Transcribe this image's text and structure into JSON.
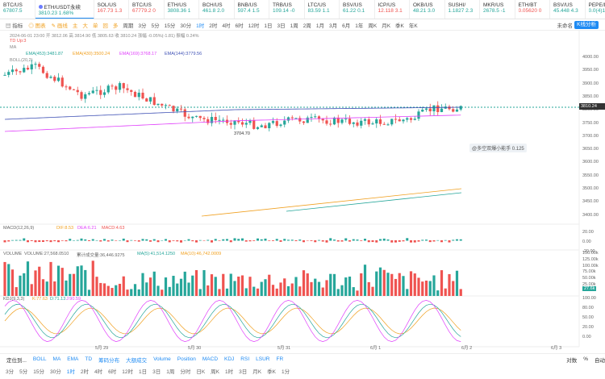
{
  "tickers": [
    {
      "name": "BTC/US",
      "value": "67807.5",
      "color": "#26a69a",
      "dot": false
    },
    {
      "name": "ETH/USDT永续",
      "value": "3810.23 1.68%",
      "color": "#26a69a",
      "dot": true,
      "active": true
    },
    {
      "name": "SOL/US",
      "value": "167.73 1.3",
      "color": "#ef5350",
      "dot": false
    },
    {
      "name": "BTC/US",
      "value": "67779.2 0",
      "color": "#ef5350",
      "dot": false
    },
    {
      "name": "ETH/US",
      "value": "3808.36 1",
      "color": "#26a69a",
      "dot": false
    },
    {
      "name": "BCH/US",
      "value": "461.8 2.0",
      "color": "#26a69a",
      "dot": false
    },
    {
      "name": "BNB/US",
      "value": "597.4 1.5",
      "color": "#26a69a",
      "dot": false
    },
    {
      "name": "TRB/US",
      "value": "109.14 -0",
      "color": "#26a69a",
      "dot": false
    },
    {
      "name": "LTC/US",
      "value": "83.59 1.1",
      "color": "#26a69a",
      "dot": false
    },
    {
      "name": "BSV/US",
      "value": "61.22 0.1",
      "color": "#26a69a",
      "dot": false
    },
    {
      "name": "ICP/US",
      "value": "12.118 3.1",
      "color": "#ef5350",
      "dot": false
    },
    {
      "name": "OKB/US",
      "value": "48.21 3.0",
      "color": "#26a69a",
      "dot": false
    },
    {
      "name": "SUSHI/",
      "value": "1.1827 2.3",
      "color": "#26a69a",
      "dot": false
    },
    {
      "name": "MKR/US",
      "value": "2678.5 -1",
      "color": "#26a69a",
      "dot": false
    },
    {
      "name": "ETH/BT",
      "value": "0.05620 0",
      "color": "#ef5350",
      "dot": false
    },
    {
      "name": "BSV/US",
      "value": "45.448 4.3",
      "color": "#26a69a",
      "dot": false
    },
    {
      "name": "PEPE/L",
      "value": "0.0(4)155k",
      "color": "#26a69a",
      "dot": false
    }
  ],
  "toolbar": {
    "items": [
      "指标",
      "图表",
      "画线"
    ],
    "intervals": [
      "主",
      "大",
      "单",
      "回",
      "多",
      "周期",
      "3分",
      "5分",
      "15分",
      "30分",
      "1时",
      "2时",
      "4时",
      "6时",
      "12时",
      "1日",
      "3日",
      "1周",
      "2周",
      "1月",
      "3月",
      "6月",
      "1年",
      "周K",
      "月K",
      "季K",
      "年K"
    ],
    "active_interval": "1时",
    "right": [
      "未命名",
      "K线分析"
    ]
  },
  "info": {
    "line1": "2024-06-01 23:00 开 3812.06 高 3814.90 低 3805.63 收 3810.24 涨幅 -0.05%(-1.81) 振幅 0.24%",
    "td": "TD Up:3",
    "ma": "MA",
    "ema": "EMA(453):3481.87",
    "ema2": "EMA(430):3500.24",
    "ema3": "EMA(169):3768.17",
    "ema4": "EMA(144):3779.56",
    "boll": "BOLL(20,2)"
  },
  "price_axis": [
    "4000.00",
    "3950.00",
    "3900.00",
    "3850.00",
    "3800.00",
    "3750.00",
    "3700.00",
    "3650.00",
    "3600.00",
    "3550.00",
    "3500.00",
    "3450.00",
    "3400.00"
  ],
  "current_price": "3810.24",
  "low_label": "3704.70",
  "annotation": "@多空双爆小能手 0.125",
  "macd": {
    "label": "MACD(12,26,9)",
    "dif": "DIF:8.53",
    "dea": "DEA:6.21",
    "macd": "MACD:4.63",
    "axis": [
      "20.00",
      "0.00",
      "-20.00"
    ]
  },
  "volume": {
    "label": "VOLUME",
    "v1": "VOLUME:27,568.0510",
    "v2": "累计成交量:36,446.9275",
    "v3": "MA(5):41,514.1250",
    "v4": "MA(10):46,742.0009",
    "axis": [
      "150.00k",
      "125.00k",
      "100.00k",
      "75.00k",
      "50.00k",
      "25.00k",
      "27.6k"
    ]
  },
  "kdj": {
    "label": "KDJ(9,3,3)",
    "k": "K:77.63",
    "d": "D:71.13",
    "j": "J:90.59",
    "axis": [
      "100.00",
      "80.00",
      "50.00",
      "20.00",
      "0.00"
    ]
  },
  "dates": [
    "5月 29",
    "5月 30",
    "5月 31",
    "6月 1",
    "6月 2",
    "6月 3"
  ],
  "bottom": {
    "items": [
      "定位到...",
      "BOLL",
      "MA",
      "EMA",
      "TD",
      "筹码分布",
      "大额成交",
      "Volume",
      "Position",
      "MACD",
      "KDJ",
      "RSI",
      "LSUR",
      "FR"
    ],
    "right": [
      "对数",
      "%",
      "自动"
    ]
  },
  "bottom2": [
    "3分",
    "5分",
    "15分",
    "30分",
    "1时",
    "2时",
    "4时",
    "6时",
    "12时",
    "1日",
    "3日",
    "1周",
    "分时",
    "日K",
    "周K",
    "1时",
    "3日",
    "月K",
    "季K",
    "1分"
  ],
  "bottom2_active": "1时"
}
